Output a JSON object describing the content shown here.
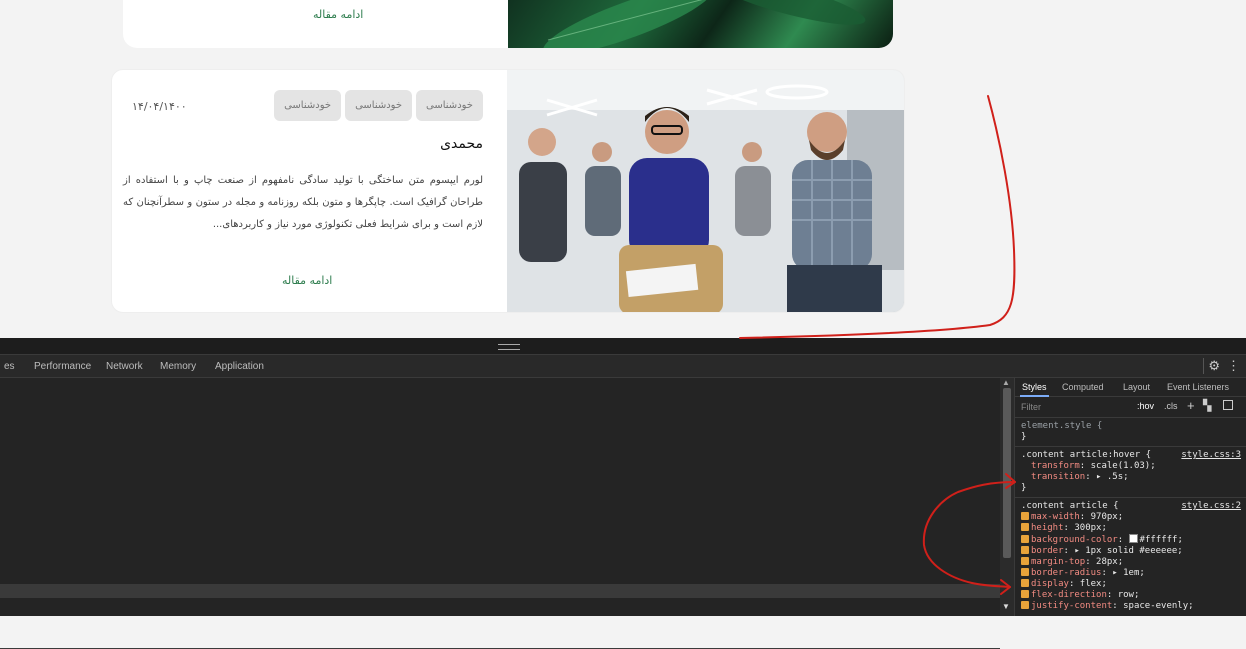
{
  "blog": {
    "prev_card": {
      "read_more": "ادامه مقاله"
    },
    "card": {
      "date": "۱۴/۰۴/۱۴۰۰",
      "tags": [
        "خودشناسی",
        "خودشناسی",
        "خودشناسی"
      ],
      "author": "محمدی",
      "excerpt": "لورم ایپسوم متن ساختگی با تولید سادگی نامفهوم از صنعت چاپ و با استفاده از طراحان گرافیک است. چاپگرها و متون بلکه روزنامه و مجله در ستون و سطرآنچنان که لازم است و برای شرایط فعلی تکنولوژی مورد نیاز و کاربردهای...",
      "read_more": "ادامه مقاله"
    }
  },
  "devtools": {
    "tabs": [
      "es",
      "Performance",
      "Network",
      "Memory",
      "Application"
    ],
    "styles_pane": {
      "tabs": [
        "Styles",
        "Computed",
        "Layout",
        "Event Listeners"
      ],
      "filter_placeholder": "Filter",
      "hov": ":hov",
      "cls": ".cls",
      "rules": [
        {
          "selector": "element.style {",
          "source": ""
        },
        {
          "selector": ".content article:hover {",
          "source": "style.css:3",
          "props": [
            {
              "name": "transform",
              "value": "scale(1.03);"
            },
            {
              "name": "transition",
              "value": "▸ .5s;"
            }
          ]
        },
        {
          "selector": ".content article {",
          "source": "style.css:2",
          "props": [
            {
              "name": "max-width",
              "value": "970px;"
            },
            {
              "name": "height",
              "value": "300px;"
            },
            {
              "name": "background-color",
              "value": "#ffffff;"
            },
            {
              "name": "border",
              "value": "▸ 1px solid #eeeeee;"
            },
            {
              "name": "margin-top",
              "value": "28px;"
            },
            {
              "name": "border-radius",
              "value": "▸ 1em;"
            },
            {
              "name": "display",
              "value": "flex;"
            },
            {
              "name": "flex-direction",
              "value": "row;"
            },
            {
              "name": "justify-content",
              "value": "space-evenly;"
            }
          ]
        }
      ]
    }
  },
  "colors": {
    "accent_green": "#2e7d4e",
    "annotation_red": "#d0201a",
    "devtools_bg": "#242424"
  }
}
